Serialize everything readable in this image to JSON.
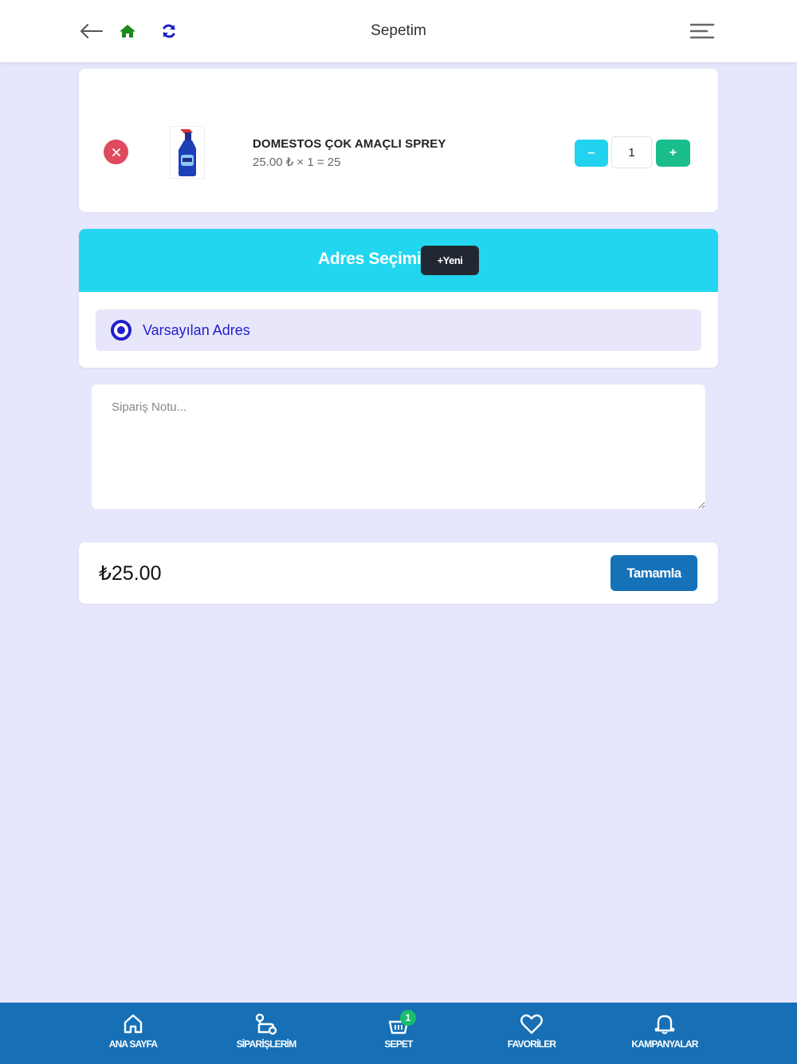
{
  "header": {
    "title": "Sepetim",
    "icons": {
      "back": "arrow-left-icon",
      "home": "home-icon",
      "refresh": "refresh-icon",
      "menu": "hamburger-menu-icon"
    },
    "colors": {
      "home": "#1a8a1a",
      "refresh": "#1f1fcc"
    }
  },
  "cart": {
    "items": [
      {
        "name": "DOMESTOS ÇOK AMAÇLI SPREY",
        "price_line": "25.00 ₺ × 1 = 25",
        "quantity": "1",
        "minus_label": "–",
        "plus_label": "+"
      }
    ]
  },
  "address": {
    "title": "Adres Seçimi",
    "new_label": "+Yeni",
    "options": [
      {
        "label": "Varsayılan Adres",
        "selected": true
      }
    ]
  },
  "note": {
    "placeholder": "Sipariş Notu..."
  },
  "summary": {
    "total": "₺25.00",
    "complete_label": "Tamamla"
  },
  "bottom_nav": [
    {
      "label": "ANA SAYFA",
      "icon": "home-icon"
    },
    {
      "label": "SİPARİŞLERİM",
      "icon": "route-icon"
    },
    {
      "label": "SEPET",
      "icon": "basket-icon",
      "badge": "1"
    },
    {
      "label": "FAVORİLER",
      "icon": "heart-icon"
    },
    {
      "label": "KAMPANYALAR",
      "icon": "bell-icon"
    }
  ],
  "colors": {
    "background": "#e6e6fd",
    "accent_cyan": "#22d6f0",
    "nav_blue": "#1770b5",
    "remove_red": "#e04a5f",
    "plus_green": "#1abd8c"
  }
}
